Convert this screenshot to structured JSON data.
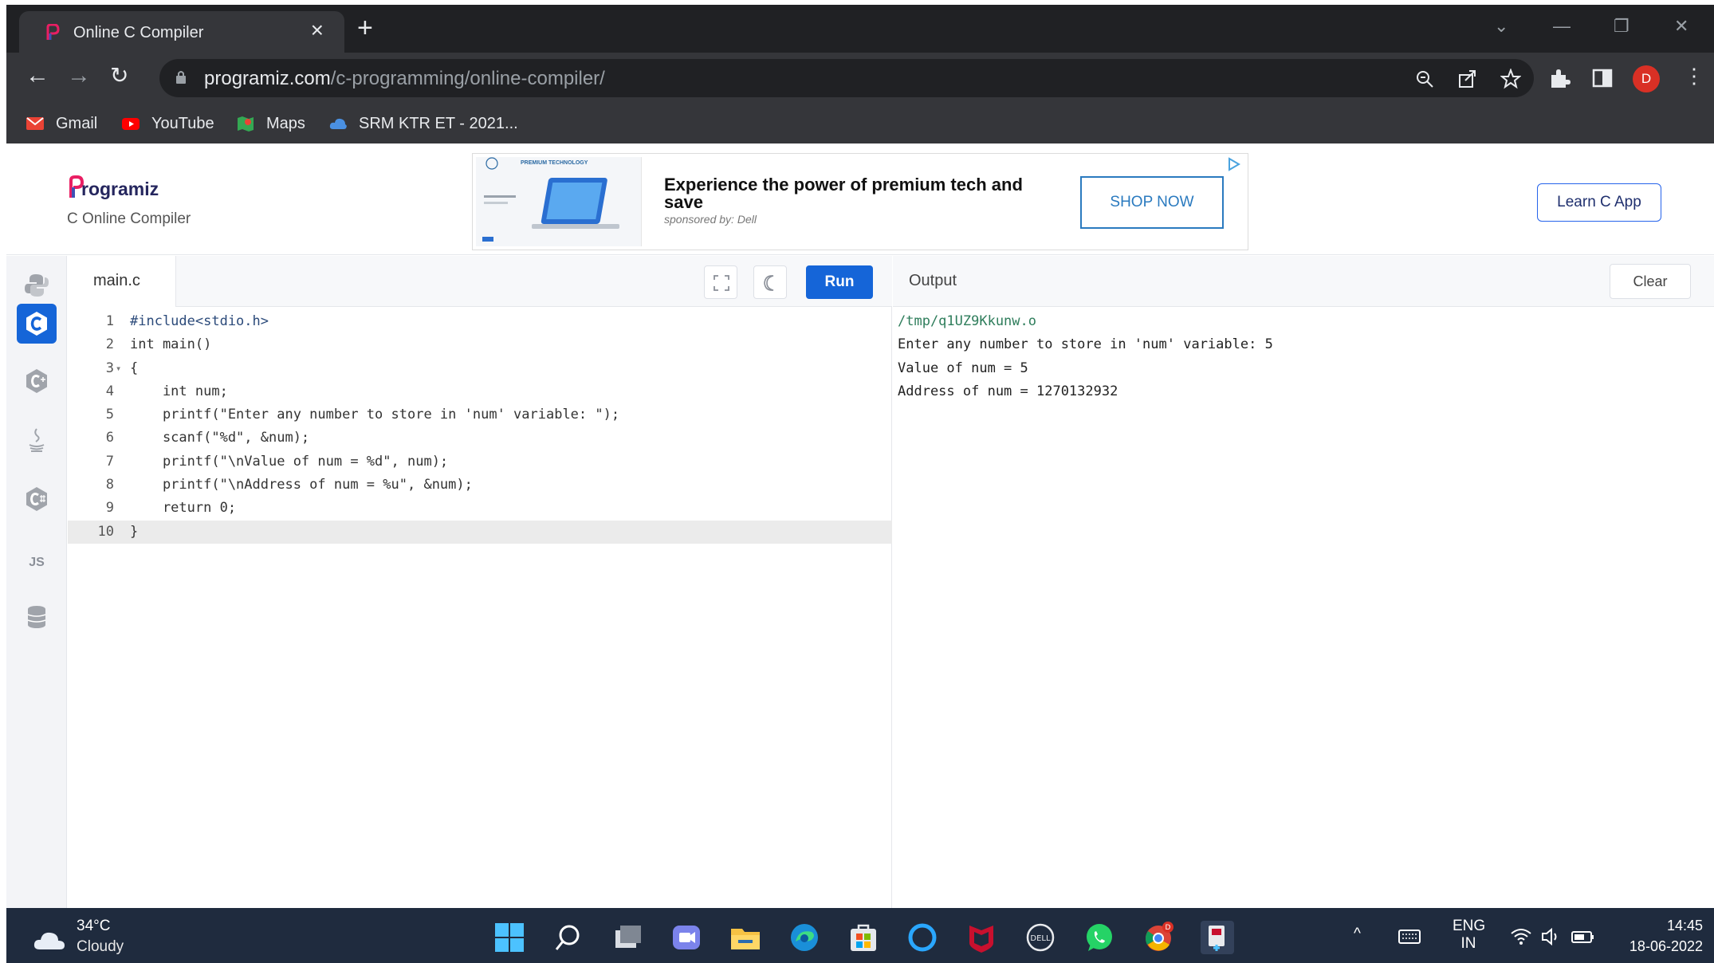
{
  "browser": {
    "tab_title": "Online C Compiler",
    "url_domain": "programiz.com",
    "url_path": "/c-programming/online-compiler/",
    "avatar_letter": "D",
    "bookmarks": [
      {
        "label": "Gmail"
      },
      {
        "label": "YouTube"
      },
      {
        "label": "Maps"
      },
      {
        "label": "SRM KTR ET - 2021..."
      }
    ]
  },
  "site": {
    "brand": "rogramiz",
    "subtitle": "C Online Compiler",
    "learn_button": "Learn C App"
  },
  "ad": {
    "headline": "Experience the power of premium tech and save",
    "sponsor": "sponsored by: Dell",
    "cta": "SHOP NOW",
    "image_caption": "PREMIUM TECHNOLOGY"
  },
  "sidebar": {
    "languages": [
      "python",
      "c",
      "cpp",
      "java",
      "csharp",
      "js",
      "sql"
    ],
    "active": "c",
    "js_label": "JS"
  },
  "editor": {
    "file_name": "main.c",
    "run_label": "Run",
    "current_line": 10,
    "lines": [
      {
        "num": "1",
        "text": "#include<stdio.h>"
      },
      {
        "num": "2",
        "text": "int main()"
      },
      {
        "num": "3",
        "text": "{"
      },
      {
        "num": "4",
        "text": "    int num;"
      },
      {
        "num": "5",
        "text": "    printf(\"Enter any number to store in 'num' variable: \");"
      },
      {
        "num": "6",
        "text": "    scanf(\"%d\", &num);"
      },
      {
        "num": "7",
        "text": "    printf(\"\\nValue of num = %d\", num);"
      },
      {
        "num": "8",
        "text": "    printf(\"\\nAddress of num = %u\", &num);"
      },
      {
        "num": "9",
        "text": "    return 0;"
      },
      {
        "num": "10",
        "text": "}"
      }
    ]
  },
  "output": {
    "title": "Output",
    "clear_label": "Clear",
    "lines": [
      "/tmp/q1UZ9Kkunw.o",
      "Enter any number to store in 'num' variable: 5",
      "Value of num = 5",
      "Address of num = 1270132932"
    ]
  },
  "taskbar": {
    "temperature": "34°C",
    "condition": "Cloudy",
    "language": "ENG",
    "region": "IN",
    "time": "14:45",
    "date": "18-06-2022"
  },
  "colors": {
    "accent": "#1565d8",
    "chrome_dark": "#202124",
    "chrome_mid": "#35363a",
    "taskbar": "#1f2b3e"
  }
}
